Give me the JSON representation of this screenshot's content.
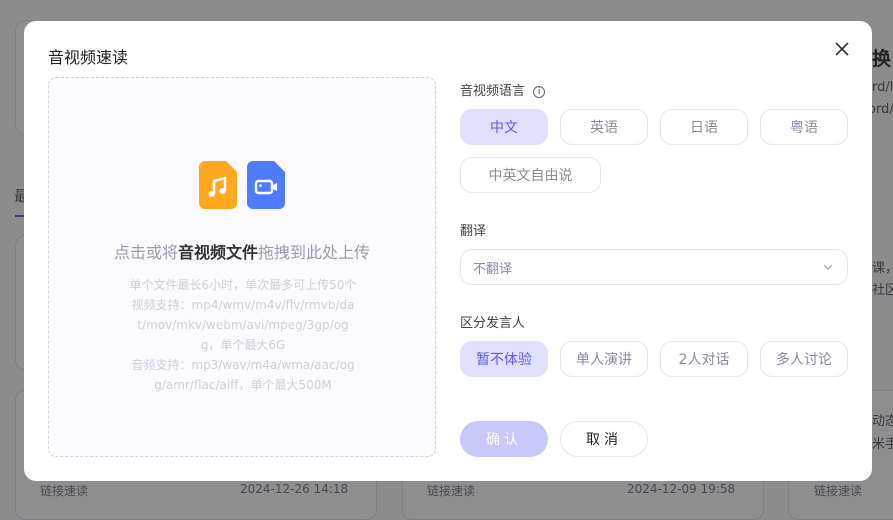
{
  "background": {
    "tab_label": "最",
    "right_texts": [
      "换",
      "rd/l",
      "ord/",
      "课，",
      "社区",
      "动态",
      "米手"
    ],
    "cards": [
      {
        "type": "链接速读",
        "time": "2024-12-26 14:18"
      },
      {
        "type": "链接速读",
        "time": "2024-12-09 19:58"
      },
      {
        "type": "链接速读",
        "time": ""
      }
    ]
  },
  "dialog": {
    "title": "音视频速读",
    "close_icon": "close-icon",
    "upload": {
      "text_before": "点击或将",
      "text_bold": "音视频文件",
      "text_after": "拖拽到此处上传",
      "hint_lines": [
        "单个文件最长6小时，单次最多可上传50个",
        "视频支持：mp4/wmv/m4v/flv/rmvb/dat/mov/mkv/webm/avi/mpeg/3gp/ogg，单个最大6G",
        "音频支持：mp3/wav/m4a/wma/aac/ogg/amr/flac/aiff，单个最大500M"
      ],
      "icons": [
        "audio-file-icon",
        "video-file-icon"
      ],
      "audio_color": "#FFA820",
      "video_color": "#4F7CFF"
    },
    "language": {
      "label": "音视频语言",
      "options": [
        "中文",
        "英语",
        "日语",
        "粤语",
        "中英文自由说"
      ],
      "selected": "中文"
    },
    "translate": {
      "label": "翻译",
      "value": "不翻译"
    },
    "speaker": {
      "label": "区分发言人",
      "options": [
        "暂不体验",
        "单人演讲",
        "2人对话",
        "多人讨论"
      ],
      "selected": "暂不体验"
    },
    "confirm_label": "确认",
    "cancel_label": "取消",
    "accent_color": "#5B5BF0"
  }
}
